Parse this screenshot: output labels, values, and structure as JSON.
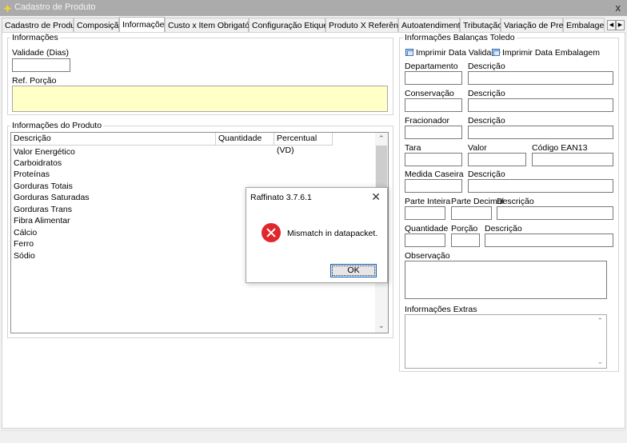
{
  "window": {
    "title": "Cadastro de Produto",
    "close_glyph": "x"
  },
  "tabs": [
    {
      "label": "Cadastro de Produto"
    },
    {
      "label": "Composição"
    },
    {
      "label": "Informações"
    },
    {
      "label": "Custo x Item Obrigatório"
    },
    {
      "label": "Configuração Etiqueta"
    },
    {
      "label": "Produto X Referência"
    },
    {
      "label": "Autoatendimento"
    },
    {
      "label": "Tributação"
    },
    {
      "label": "Variação de Preço"
    },
    {
      "label": "Embalagem"
    }
  ],
  "tab_scroll": {
    "left": "◀",
    "right": "▶"
  },
  "informacoes": {
    "group_title": "Informações",
    "validade_label": "Validade (Dias)",
    "validade_value": "",
    "ref_porcao_label": "Ref. Porção",
    "ref_porcao_value": ""
  },
  "produto": {
    "group_title": "Informações do Produto",
    "columns": [
      "Descrição",
      "Quantidade",
      "Percentual (VD)"
    ],
    "rows": [
      "Valor Energético",
      "Carboidratos",
      "Proteínas",
      "Gorduras Totais",
      "Gorduras Saturadas",
      "Gorduras Trans",
      "Fibra Alimentar",
      "Cálcio",
      "Ferro",
      "Sódio"
    ],
    "scroll_up": "⌃",
    "scroll_down": "⌄"
  },
  "toledo": {
    "group_title": "Informações Balanças Toledo",
    "imprimir_validade": "Imprimir Data Validade",
    "imprimir_embalagem": "Imprimir Data Embalagem",
    "departamento": "Departamento",
    "descricao": "Descrição",
    "conservacao": "Conservação",
    "fracionador": "Fracionador",
    "tara": "Tara",
    "valor": "Valor",
    "codigo_ean": "Código EAN13",
    "medida_caseira": "Medida Caseira",
    "parte_inteira": "Parte Inteira",
    "parte_decimal": "Parte Decimal",
    "quantidade": "Quantidade",
    "porcao": "Porção",
    "observacao": "Observação",
    "info_extras": "Informações Extras",
    "extras_up": "⌃",
    "extras_down": "⌄"
  },
  "dialog": {
    "title": "Raffinato 3.7.6.1",
    "message": "Mismatch in datapacket.",
    "ok_label": "OK",
    "close_glyph": "✕"
  }
}
